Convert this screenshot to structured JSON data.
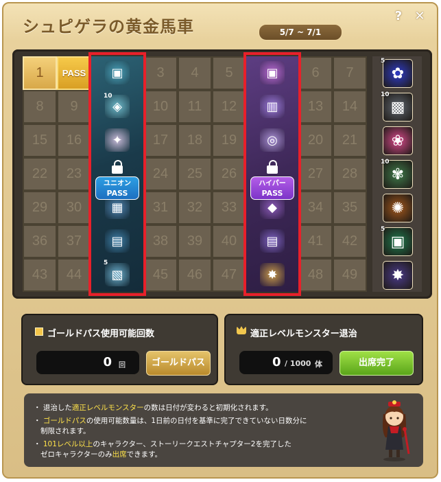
{
  "window": {
    "title": "シュピゲラの黄金馬車",
    "date_range": "5/7 ~ 7/1",
    "help_icon": "?",
    "close_icon": "✕"
  },
  "board": {
    "today": "1",
    "pass_label": "PASS",
    "rows": [
      [
        "1",
        "PASS",
        "",
        "3",
        "4",
        "5",
        "",
        "6",
        "7"
      ],
      [
        "8",
        "9",
        "",
        "10",
        "11",
        "12",
        "",
        "13",
        "14"
      ],
      [
        "15",
        "16",
        "",
        "17",
        "18",
        "19",
        "",
        "20",
        "21"
      ],
      [
        "22",
        "23",
        "",
        "24",
        "25",
        "26",
        "",
        "27",
        "28"
      ],
      [
        "29",
        "30",
        "",
        "31",
        "32",
        "33",
        "",
        "34",
        "35"
      ],
      [
        "36",
        "37",
        "",
        "38",
        "39",
        "40",
        "",
        "41",
        "42"
      ],
      [
        "43",
        "44",
        "",
        "45",
        "46",
        "47",
        "",
        "48",
        "49"
      ]
    ],
    "union_badge": {
      "line1": "ユニオン",
      "line2": "PASS"
    },
    "hyper_badge": {
      "line1": "ハイパー",
      "line2": "PASS"
    },
    "union_items": [
      "chest-icon",
      "bag-icon",
      "wing-icon",
      "ticket-icon",
      "card-icon",
      "scroll-icon",
      "blueprint-icon"
    ],
    "hyper_items": [
      "chest-icon",
      "coin-icon",
      "ring-icon",
      "potion-icon",
      "gem-icon",
      "scroll-icon",
      "staff-icon"
    ],
    "union_top_count": "10",
    "union_bottom_count": "5",
    "rewards": [
      {
        "icon": "maple-leaf-icon",
        "count": "5"
      },
      {
        "icon": "coupon-icon",
        "count": "10"
      },
      {
        "icon": "gift-box-icon",
        "count": ""
      },
      {
        "icon": "flower-icon",
        "count": "10"
      },
      {
        "icon": "food-icon",
        "count": ""
      },
      {
        "icon": "cube-icon",
        "count": "5"
      },
      {
        "icon": "golden-staff-icon",
        "count": ""
      }
    ]
  },
  "gold_pass": {
    "label": "ゴールドパス使用可能回数",
    "count": "0",
    "unit": "回",
    "button": "ゴールドパス"
  },
  "monster": {
    "label": "適正レベルモンスター退治",
    "count": "0",
    "total": "/ 1000",
    "unit": "体",
    "button": "出席完了"
  },
  "notes": [
    {
      "parts": [
        {
          "t": "退治した",
          "hl": false
        },
        {
          "t": "適正レベルモンスター",
          "hl": true
        },
        {
          "t": "の数は日付が変わると初期化されます。",
          "hl": false
        }
      ]
    },
    {
      "parts": [
        {
          "t": "ゴールドパス",
          "hl": true
        },
        {
          "t": "の使用可能数量は、1日前の日付を基準に完了できていない日数分に",
          "hl": false
        }
      ],
      "cont": "制限されます。"
    },
    {
      "parts": [
        {
          "t": "101レベル以上",
          "hl": true
        },
        {
          "t": "のキャラクター、ストーリークエストチャプター2を完了した",
          "hl": false
        }
      ],
      "cont2": [
        {
          "t": "ゼロキャラクターのみ",
          "hl": false
        },
        {
          "t": "出席",
          "hl": true
        },
        {
          "t": "できます。",
          "hl": false
        }
      ]
    }
  ]
}
